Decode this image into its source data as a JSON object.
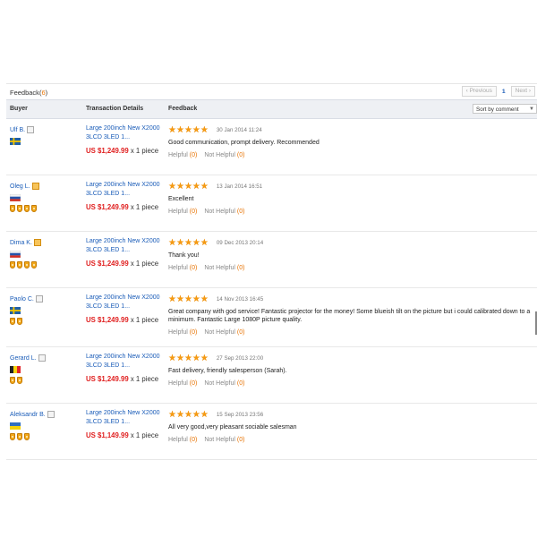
{
  "header": {
    "title": "Feedback",
    "count_open": "(",
    "count": "6",
    "count_close": ")",
    "prev": "‹ Previous",
    "page": "1",
    "next": "Next ›"
  },
  "columns": {
    "buyer": "Buyer",
    "transaction": "Transaction Details",
    "feedback": "Feedback"
  },
  "sort": {
    "label": "Sort by comment"
  },
  "helpful_label": "Helpful",
  "not_helpful_label": "Not Helpful",
  "colors": {
    "link": "#1a5cb8",
    "price": "#e02020",
    "star": "#f59a12",
    "count": "#e77200"
  },
  "reviews": [
    {
      "buyer": "Ulf B.",
      "badge": "grey",
      "flag": "sweden",
      "medals": 0,
      "product": "Large 200inch New X2000 3LCD 3LED 1...",
      "price": "US $1,249.99",
      "qty": " x 1 piece",
      "rating": 5,
      "date": "30 Jan 2014 11:24",
      "text": "Good communication, prompt delivery. Recommended",
      "helpful": "(0)",
      "not_helpful": "(0)"
    },
    {
      "buyer": "Oleg L.",
      "badge": "orange",
      "flag": "russia",
      "medals": 4,
      "product": "Large 200inch New X2000 3LCD 3LED 1...",
      "price": "US $1,249.99",
      "qty": " x 1 piece",
      "rating": 5,
      "date": "13 Jan 2014 16:51",
      "text": "Excellent",
      "helpful": "(0)",
      "not_helpful": "(0)"
    },
    {
      "buyer": "Dima K.",
      "badge": "orange",
      "flag": "russia",
      "medals": 4,
      "product": "Large 200inch New X2000 3LCD 3LED 1...",
      "price": "US $1,249.99",
      "qty": " x 1 piece",
      "rating": 5,
      "date": "09 Dec 2013 20:14",
      "text": "Thank you!",
      "helpful": "(0)",
      "not_helpful": "(0)"
    },
    {
      "buyer": "Paolo C.",
      "badge": "grey",
      "flag": "sweden",
      "medals": 2,
      "product": "Large 200inch New X2000 3LCD 3LED 1...",
      "price": "US $1,249.99",
      "qty": " x 1 piece",
      "rating": 5,
      "date": "14 Nov 2013 16:45",
      "text": "Great company with god service! Fantastic projector for the money! Some blueish tilt on the picture but i could calibrated down to a minimum. Fantastic Large 1080P picture quality.",
      "helpful": "(0)",
      "not_helpful": "(0)"
    },
    {
      "buyer": "Gerard L.",
      "badge": "grey",
      "flag": "belgium",
      "medals": 2,
      "product": "Large 200inch New X2000 3LCD 3LED 1...",
      "price": "US $1,249.99",
      "qty": " x 1 piece",
      "rating": 5,
      "date": "27 Sep 2013 22:00",
      "text": "Fast delivery, friendly salesperson (Sarah).",
      "helpful": "(0)",
      "not_helpful": "(0)"
    },
    {
      "buyer": "Aleksandr B.",
      "badge": "grey",
      "flag": "ukraine",
      "medals": 3,
      "product": "Large 200inch New X2000 3LCD 3LED 1...",
      "price": "US $1,149.99",
      "qty": " x 1 piece",
      "rating": 5,
      "date": "15 Sep 2013 23:56",
      "text": "All very good,very pleasant sociable salesman",
      "helpful": "(0)",
      "not_helpful": "(0)"
    }
  ]
}
